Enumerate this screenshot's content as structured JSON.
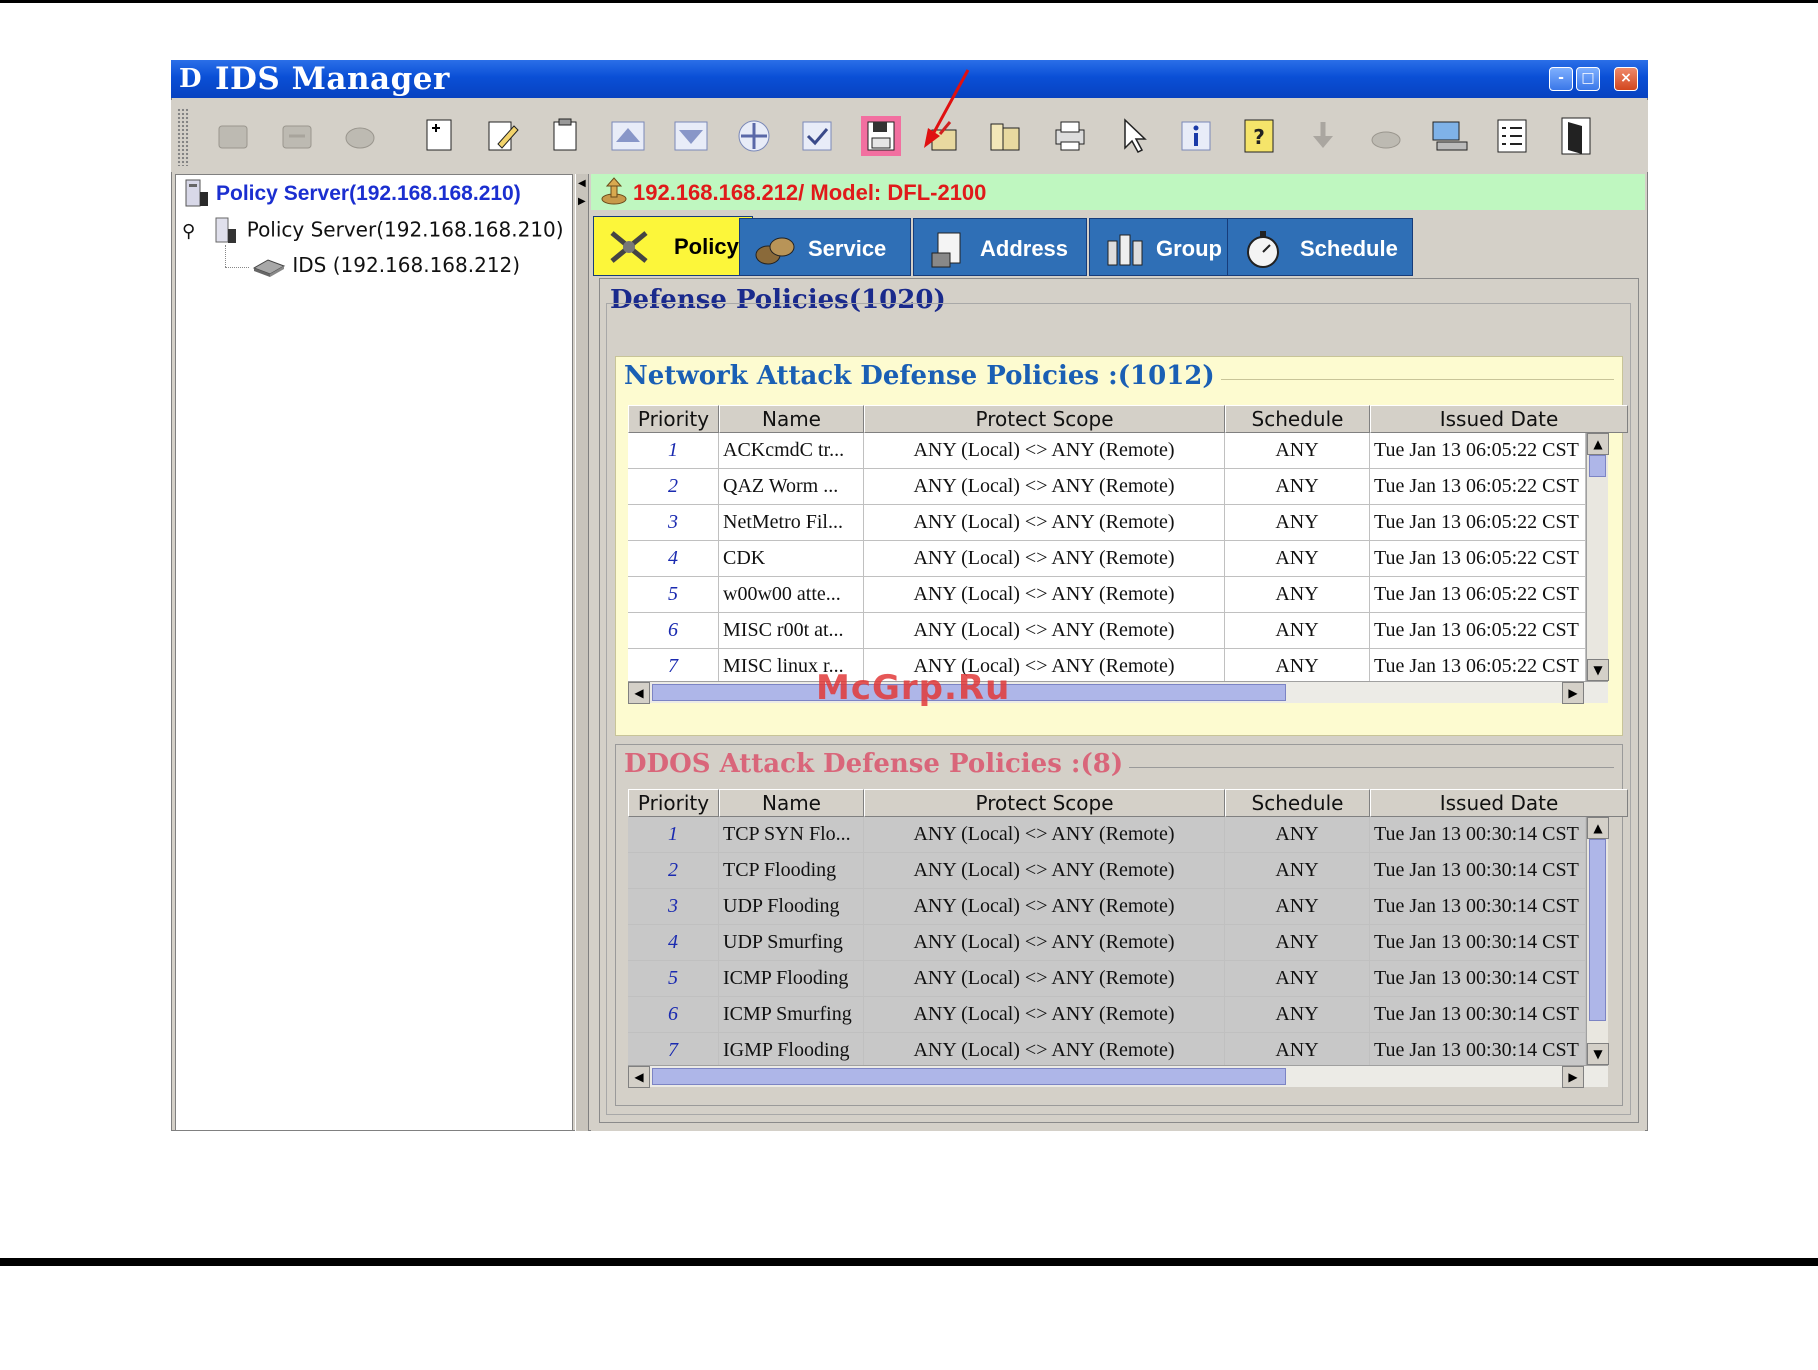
{
  "window": {
    "logo": "D",
    "title": "IDS Manager"
  },
  "title_buttons": [
    "-",
    "□",
    "×"
  ],
  "toolbar": {
    "icons": [
      "disabled-connect-icon",
      "disabled-disconnect-icon",
      "disabled-refresh-icon",
      "add-policy-icon",
      "edit-policy-icon",
      "clipboard-icon",
      "move-up-icon",
      "move-down-icon",
      "move-icon",
      "check-icon",
      "save-icon",
      "export-icon",
      "import-icon",
      "print-icon",
      "pointer-icon",
      "info-icon",
      "help-icon",
      "disabled-download-icon",
      "disabled-upload-icon",
      "monitor-icon",
      "list-icon",
      "exit-icon"
    ]
  },
  "left": {
    "header": "Policy Server(192.168.168.210)",
    "tree": [
      {
        "label": "Policy Server(192.168.168.210)"
      },
      {
        "label": "IDS (192.168.168.212)"
      }
    ]
  },
  "device_bar": {
    "text": "192.168.168.212/ Model: DFL-2100"
  },
  "tabs": [
    {
      "label": "Policy",
      "icon": "policy-icon",
      "active": true
    },
    {
      "label": "Service",
      "icon": "service-icon",
      "active": false
    },
    {
      "label": "Address",
      "icon": "address-icon",
      "active": false
    },
    {
      "label": "Group",
      "icon": "group-icon",
      "active": false
    },
    {
      "label": "Schedule",
      "icon": "stopwatch-icon",
      "active": false
    }
  ],
  "defense": {
    "title": "Defense Policies(1020)"
  },
  "network": {
    "title": "Network Attack Defense Policies :(1012)",
    "columns": [
      "Priority",
      "Name",
      "Protect Scope",
      "Schedule",
      "Issued Date"
    ],
    "rows": [
      [
        "1",
        "ACKcmdC tr...",
        "ANY (Local) <> ANY (Remote)",
        "ANY",
        "Tue Jan 13 06:05:22 CST"
      ],
      [
        "2",
        "QAZ Worm ...",
        "ANY (Local) <> ANY (Remote)",
        "ANY",
        "Tue Jan 13 06:05:22 CST"
      ],
      [
        "3",
        "NetMetro Fil...",
        "ANY (Local) <> ANY (Remote)",
        "ANY",
        "Tue Jan 13 06:05:22 CST"
      ],
      [
        "4",
        "CDK",
        "ANY (Local) <> ANY (Remote)",
        "ANY",
        "Tue Jan 13 06:05:22 CST"
      ],
      [
        "5",
        "w00w00 atte...",
        "ANY (Local) <> ANY (Remote)",
        "ANY",
        "Tue Jan 13 06:05:22 CST"
      ],
      [
        "6",
        "MISC r00t at...",
        "ANY (Local) <> ANY (Remote)",
        "ANY",
        "Tue Jan 13 06:05:22 CST"
      ],
      [
        "7",
        "MISC linux r...",
        "ANY (Local) <> ANY (Remote)",
        "ANY",
        "Tue Jan 13 06:05:22 CST"
      ]
    ]
  },
  "ddos": {
    "title": "DDOS Attack Defense Policies :(8)",
    "columns": [
      "Priority",
      "Name",
      "Protect Scope",
      "Schedule",
      "Issued Date"
    ],
    "rows": [
      [
        "1",
        "TCP SYN Flo...",
        "ANY (Local) <> ANY (Remote)",
        "ANY",
        "Tue Jan 13 00:30:14 CST"
      ],
      [
        "2",
        "TCP Flooding",
        "ANY (Local) <> ANY (Remote)",
        "ANY",
        "Tue Jan 13 00:30:14 CST"
      ],
      [
        "3",
        "UDP Flooding",
        "ANY (Local) <> ANY (Remote)",
        "ANY",
        "Tue Jan 13 00:30:14 CST"
      ],
      [
        "4",
        "UDP Smurfing",
        "ANY (Local) <> ANY (Remote)",
        "ANY",
        "Tue Jan 13 00:30:14 CST"
      ],
      [
        "5",
        "ICMP Flooding",
        "ANY (Local) <> ANY (Remote)",
        "ANY",
        "Tue Jan 13 00:30:14 CST"
      ],
      [
        "6",
        "ICMP Smurfing",
        "ANY (Local) <> ANY (Remote)",
        "ANY",
        "Tue Jan 13 00:30:14 CST"
      ],
      [
        "7",
        "IGMP Flooding",
        "ANY (Local) <> ANY (Remote)",
        "ANY",
        "Tue Jan 13 00:30:14 CST"
      ]
    ]
  },
  "watermark": "McGrp.Ru",
  "colors": {
    "titlebar": "#0a4fd6",
    "active_tab": "#fcf63a",
    "inactive_tab": "#2f6fb6",
    "device_bar_bg": "#bff7c0",
    "device_text": "#e01a1a",
    "network_title": "#1a5fb4",
    "ddos_title": "#d9667a",
    "network_row_bg": "#ffffff",
    "ddos_row_bg": "#c8c8c8"
  }
}
